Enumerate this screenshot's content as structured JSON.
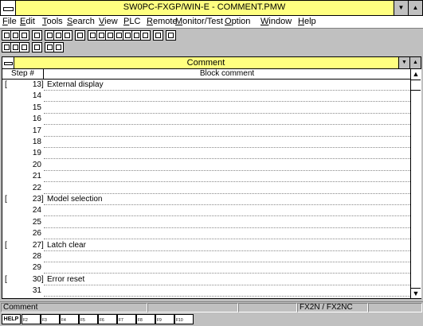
{
  "window": {
    "title": "SW0PC-FXGP/WIN-E - COMMENT.PMW"
  },
  "menu": [
    "File",
    "Edit",
    "Tools",
    "Search",
    "View",
    "PLC",
    "Remote",
    "Monitor/Test",
    "Option",
    "Window",
    "Help"
  ],
  "child": {
    "title": "Comment",
    "col_step": "Step #",
    "col_comment": "Block comment",
    "rows": [
      {
        "step": "13",
        "comment": "External display",
        "bracket": true
      },
      {
        "step": "14",
        "comment": "",
        "bracket": false
      },
      {
        "step": "15",
        "comment": "",
        "bracket": false
      },
      {
        "step": "16",
        "comment": "",
        "bracket": false
      },
      {
        "step": "17",
        "comment": "",
        "bracket": false
      },
      {
        "step": "18",
        "comment": "",
        "bracket": false
      },
      {
        "step": "19",
        "comment": "",
        "bracket": false
      },
      {
        "step": "20",
        "comment": "",
        "bracket": false
      },
      {
        "step": "21",
        "comment": "",
        "bracket": false
      },
      {
        "step": "22",
        "comment": "",
        "bracket": false
      },
      {
        "step": "23",
        "comment": "Model selection",
        "bracket": true
      },
      {
        "step": "24",
        "comment": "",
        "bracket": false
      },
      {
        "step": "25",
        "comment": "",
        "bracket": false
      },
      {
        "step": "26",
        "comment": "",
        "bracket": false
      },
      {
        "step": "27",
        "comment": "Latch clear",
        "bracket": true
      },
      {
        "step": "28",
        "comment": "",
        "bracket": false
      },
      {
        "step": "29",
        "comment": "",
        "bracket": false
      },
      {
        "step": "30",
        "comment": "Error reset",
        "bracket": true
      },
      {
        "step": "31",
        "comment": "",
        "bracket": false
      }
    ]
  },
  "status": {
    "mode": "Comment",
    "plc": "FX2N / FX2NC"
  },
  "fkeys": {
    "help": "HELP",
    "keys": [
      "F2",
      "F3",
      "F4",
      "F5",
      "F6",
      "F7",
      "F8",
      "F9",
      "F10"
    ]
  }
}
